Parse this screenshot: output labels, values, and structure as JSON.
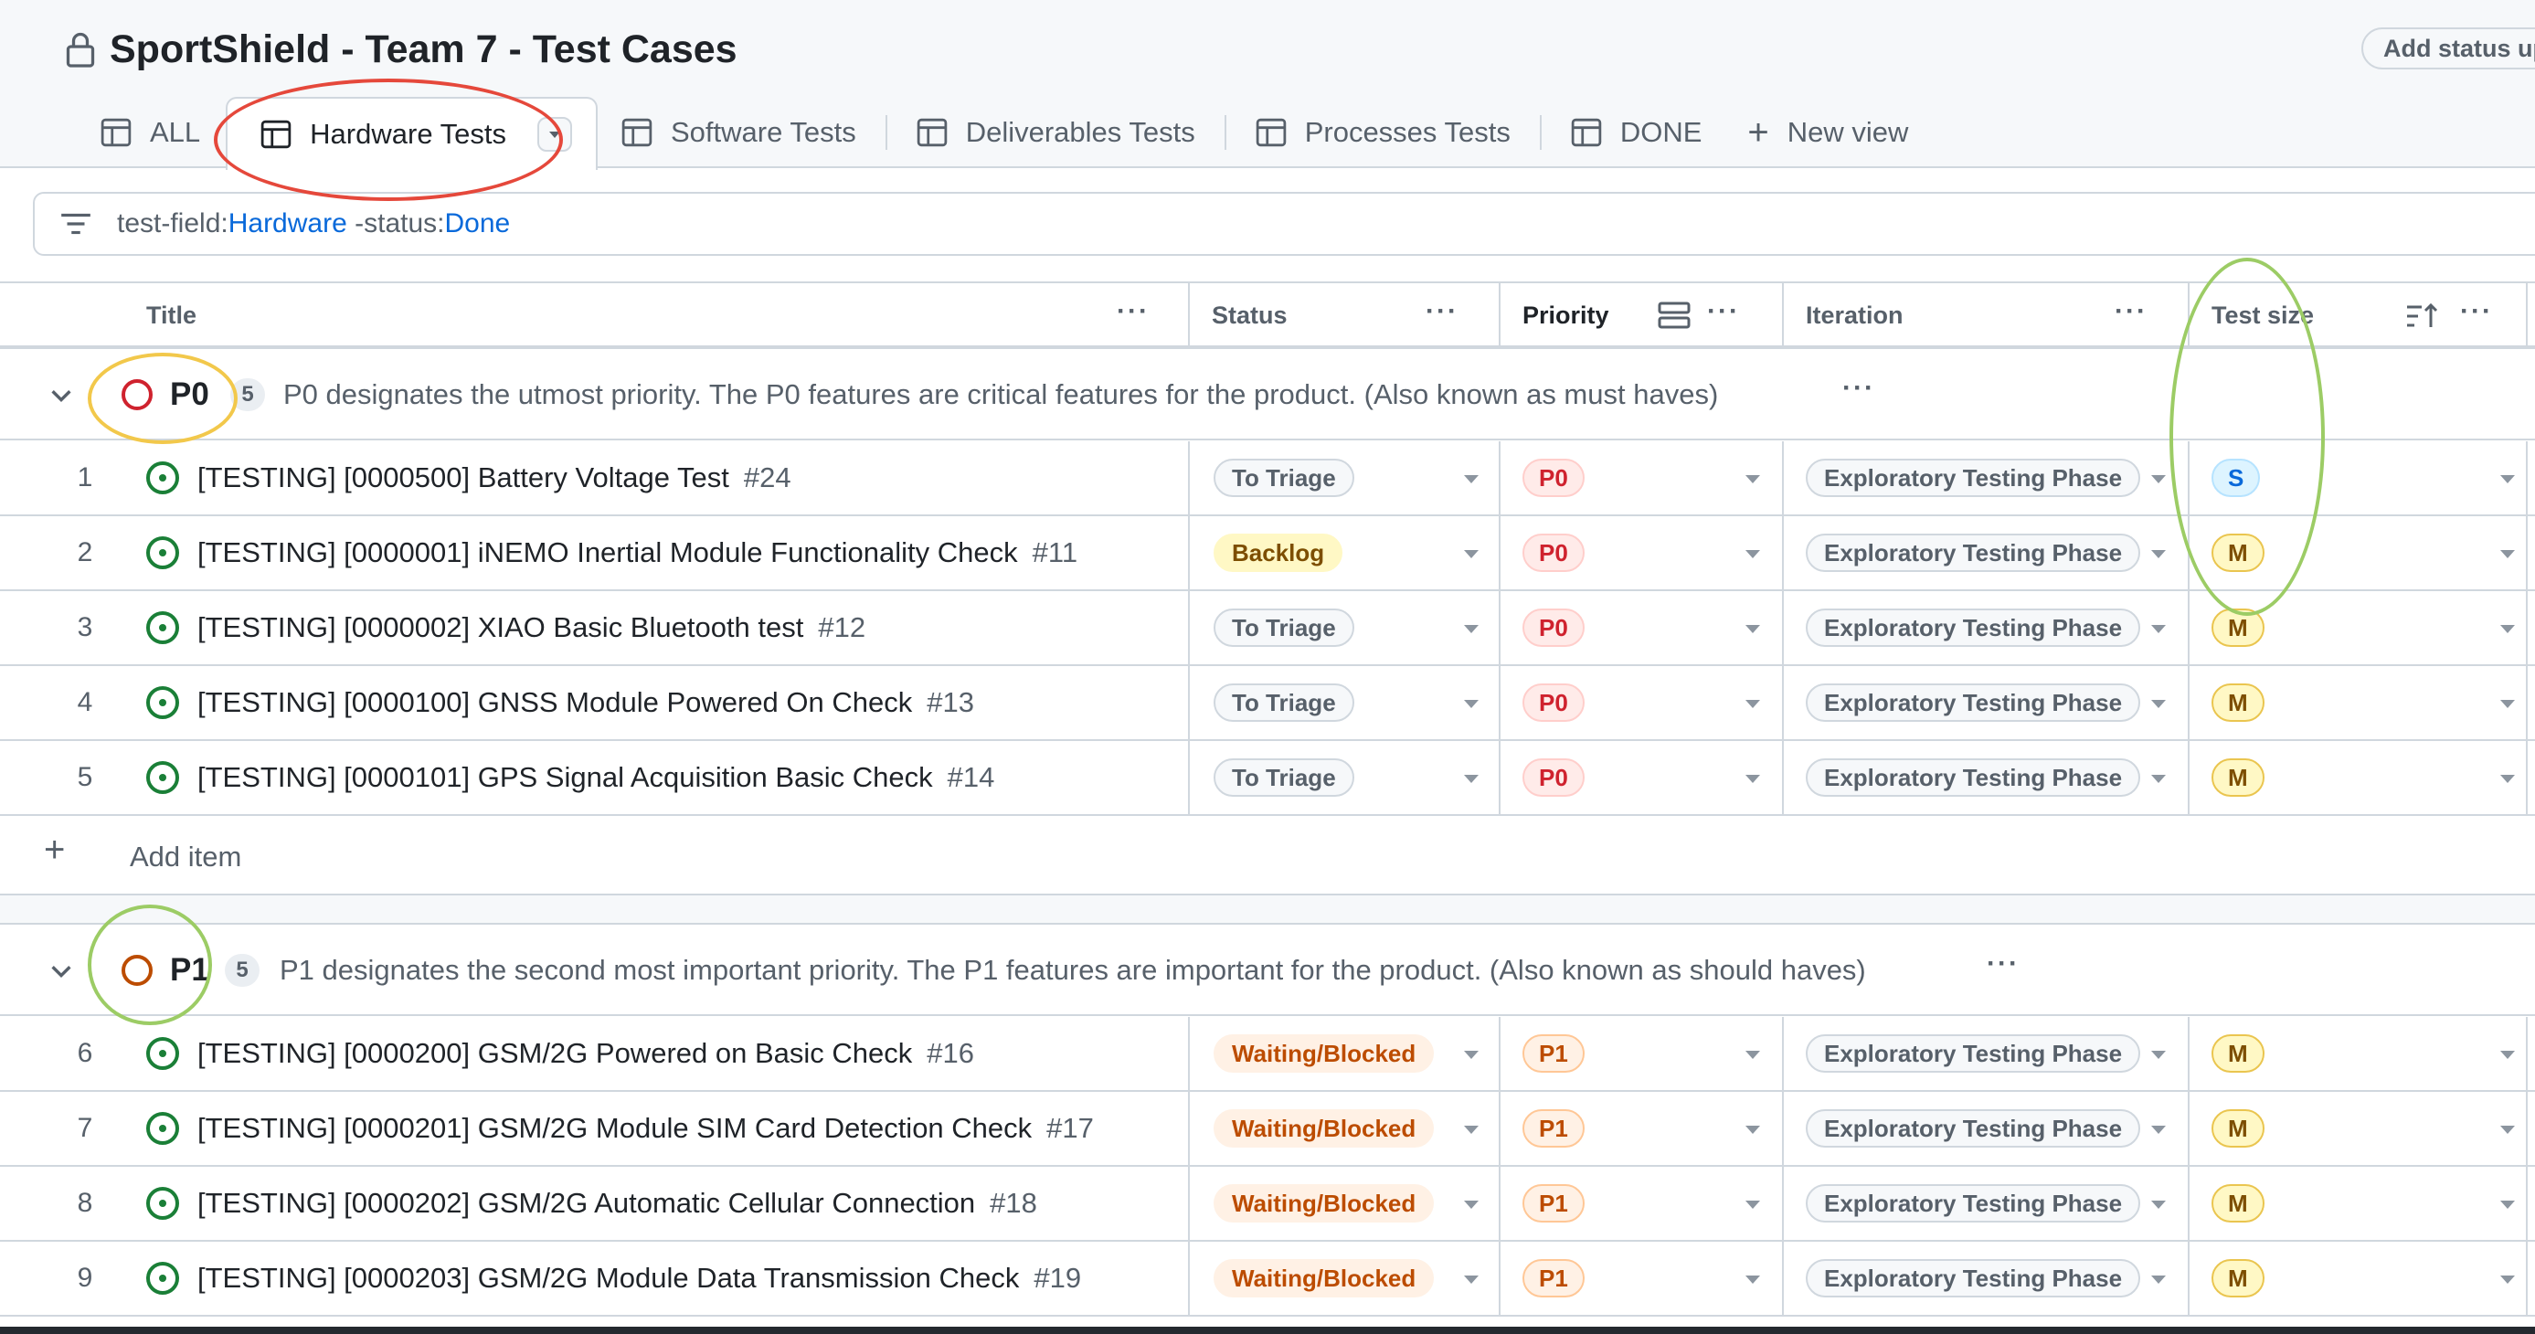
{
  "project": {
    "title": "SportShield - Team 7 - Test Cases",
    "status_button": "Add status update"
  },
  "tabs": [
    {
      "label": "ALL"
    },
    {
      "label": "Hardware Tests"
    },
    {
      "label": "Software Tests"
    },
    {
      "label": "Deliverables Tests"
    },
    {
      "label": "Processes Tests"
    },
    {
      "label": "DONE"
    }
  ],
  "new_view_label": "New view",
  "filter": {
    "part1": "test-field:",
    "part2": "Hardware",
    "part3": " -status:",
    "part4": "Done"
  },
  "columns": {
    "title": "Title",
    "status": "Status",
    "priority": "Priority",
    "iteration": "Iteration",
    "test_size": "Test size"
  },
  "groups": [
    {
      "label": "P0",
      "count": "5",
      "description": "P0 designates the utmost priority. The P0 features are critical features for the product. (Also known as must haves)",
      "rows": [
        {
          "num": "1",
          "title": "[TESTING] [0000500] Battery Voltage Test",
          "issue": "#24",
          "status": "To Triage",
          "priority": "P0",
          "iteration": "Exploratory Testing Phase",
          "size": "S"
        },
        {
          "num": "2",
          "title": "[TESTING] [0000001] iNEMO Inertial Module Functionality Check",
          "issue": "#11",
          "status": "Backlog",
          "priority": "P0",
          "iteration": "Exploratory Testing Phase",
          "size": "M"
        },
        {
          "num": "3",
          "title": "[TESTING] [0000002] XIAO Basic Bluetooth test",
          "issue": "#12",
          "status": "To Triage",
          "priority": "P0",
          "iteration": "Exploratory Testing Phase",
          "size": "M"
        },
        {
          "num": "4",
          "title": "[TESTING] [0000100] GNSS Module Powered On Check",
          "issue": "#13",
          "status": "To Triage",
          "priority": "P0",
          "iteration": "Exploratory Testing Phase",
          "size": "M"
        },
        {
          "num": "5",
          "title": "[TESTING] [0000101] GPS Signal Acquisition Basic Check",
          "issue": "#14",
          "status": "To Triage",
          "priority": "P0",
          "iteration": "Exploratory Testing Phase",
          "size": "M"
        }
      ]
    },
    {
      "label": "P1",
      "count": "5",
      "description": "P1 designates the second most important priority. The P1 features are important for the product. (Also known as should haves)",
      "rows": [
        {
          "num": "6",
          "title": "[TESTING] [0000200] GSM/2G Powered on Basic Check",
          "issue": "#16",
          "status": "Waiting/Blocked",
          "priority": "P1",
          "iteration": "Exploratory Testing Phase",
          "size": "M"
        },
        {
          "num": "7",
          "title": "[TESTING] [0000201] GSM/2G Module SIM Card Detection Check",
          "issue": "#17",
          "status": "Waiting/Blocked",
          "priority": "P1",
          "iteration": "Exploratory Testing Phase",
          "size": "M"
        },
        {
          "num": "8",
          "title": "[TESTING] [0000202] GSM/2G Automatic Cellular Connection",
          "issue": "#18",
          "status": "Waiting/Blocked",
          "priority": "P1",
          "iteration": "Exploratory Testing Phase",
          "size": "M"
        },
        {
          "num": "9",
          "title": "[TESTING] [0000203] GSM/2G Module Data Transmission Check",
          "issue": "#19",
          "status": "Waiting/Blocked",
          "priority": "P1",
          "iteration": "Exploratory Testing Phase",
          "size": "M"
        }
      ]
    }
  ],
  "add_item_label": "Add item",
  "colors": {
    "triage_bg": "#f6f8fa",
    "triage_fg": "#57606a",
    "backlog_bg": "#fff8c5",
    "backlog_fg": "#7d4e00",
    "blocked_bg": "#fff1e5",
    "blocked_fg": "#bc4c00",
    "p0_bg": "#ffebe9",
    "p0_fg": "#cf222e",
    "p1_bg": "#fff1e5",
    "p1_fg": "#bc4c00",
    "size_s_bg": "#ddf4ff",
    "size_s_fg": "#0969da",
    "size_m_bg": "#fff8c5",
    "size_m_fg": "#7d4e00",
    "annotation_red": "#e5483b",
    "annotation_yellow": "#f2c84b",
    "annotation_green": "#9ccc65"
  }
}
